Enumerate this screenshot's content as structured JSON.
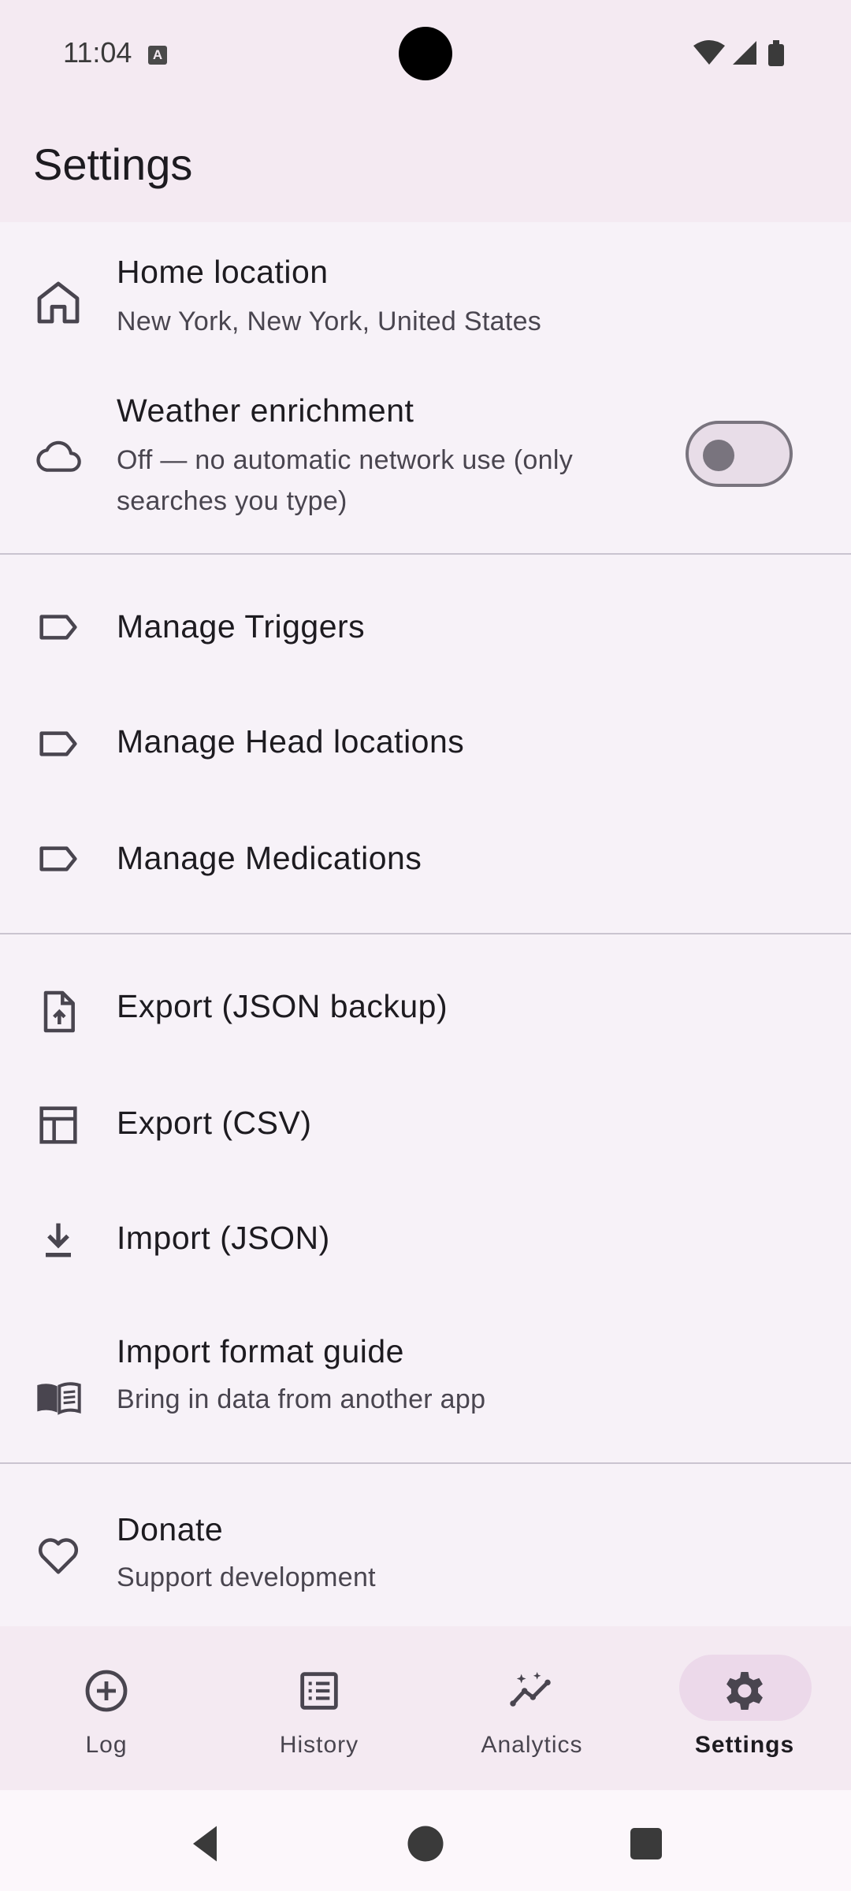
{
  "status_bar": {
    "time": "11:04",
    "notification_icon": "A",
    "icons": [
      "wifi-icon",
      "cell-signal-icon",
      "battery-icon"
    ]
  },
  "app_bar": {
    "title": "Settings"
  },
  "settings": {
    "home_location": {
      "icon": "home-icon",
      "title": "Home location",
      "subtitle": "New York, New York, United States"
    },
    "weather": {
      "icon": "cloud-icon",
      "title": "Weather enrichment",
      "subtitle_line1": "Off — no automatic network use (only",
      "subtitle_line2": "searches you type)",
      "enabled": false
    },
    "manage_triggers": {
      "icon": "label-icon",
      "title": "Manage Triggers"
    },
    "manage_head_locations": {
      "icon": "label-icon",
      "title": "Manage Head locations"
    },
    "manage_medications": {
      "icon": "label-icon",
      "title": "Manage Medications"
    },
    "export_json": {
      "icon": "file-upload-icon",
      "title": "Export (JSON backup)"
    },
    "export_csv": {
      "icon": "table-icon",
      "title": "Export (CSV)"
    },
    "import_json": {
      "icon": "download-icon",
      "title": "Import (JSON)"
    },
    "import_guide": {
      "icon": "book-icon",
      "title": "Import format guide",
      "subtitle": "Bring in data from another app"
    },
    "donate": {
      "icon": "heart-icon",
      "title": "Donate",
      "subtitle": "Support development"
    }
  },
  "bottom_nav": {
    "items": [
      {
        "label": "Log",
        "icon": "add-circle-icon",
        "active": false
      },
      {
        "label": "History",
        "icon": "list-icon",
        "active": false
      },
      {
        "label": "Analytics",
        "icon": "analytics-icon",
        "active": false
      },
      {
        "label": "Settings",
        "icon": "gear-icon",
        "active": true
      }
    ]
  },
  "colors": {
    "app_bar_bg": "#f4eaf2",
    "list_bg": "#f7f2f8",
    "divider": "#cac4d0",
    "active_indicator": "#ecd9ea"
  }
}
